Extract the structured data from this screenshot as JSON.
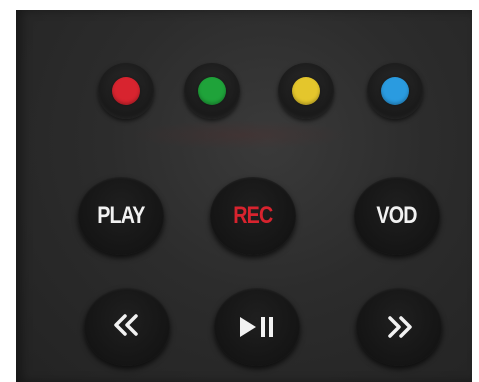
{
  "remote": {
    "color_buttons": [
      {
        "name": "red",
        "color": "#d8242f"
      },
      {
        "name": "green",
        "color": "#1fa33a"
      },
      {
        "name": "yellow",
        "color": "#e4c62c"
      },
      {
        "name": "blue",
        "color": "#2a9be0"
      }
    ],
    "buttons": {
      "play": {
        "label": "PLAY",
        "color": "#f2f2f2"
      },
      "rec": {
        "label": "REC",
        "color": "#d8232e"
      },
      "vod": {
        "label": "VOD",
        "color": "#f2f2f2"
      },
      "rewind": {
        "icon": "rewind-icon",
        "glyph": "«",
        "color": "#f2f2f2"
      },
      "play_pause": {
        "icon": "play-pause-icon",
        "glyph": "▶II",
        "color": "#f2f2f2"
      },
      "fast_forward": {
        "icon": "fast-forward-icon",
        "glyph": "»",
        "color": "#f2f2f2"
      }
    }
  }
}
